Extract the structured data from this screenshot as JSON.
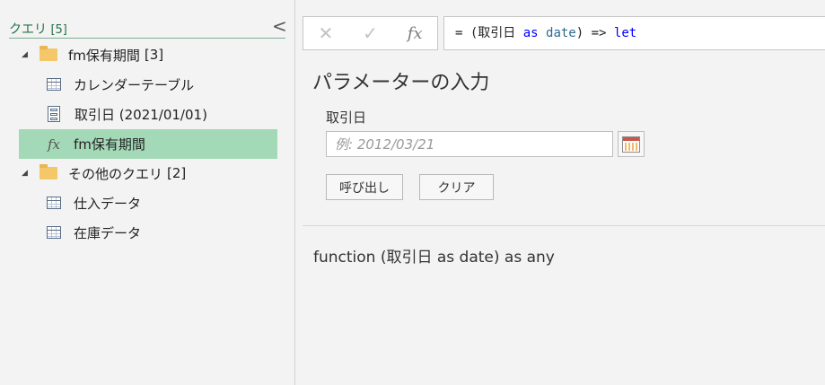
{
  "queries_pane": {
    "title": "クエリ",
    "count": "[5]",
    "collapse_glyph": "<",
    "groups": [
      {
        "name": "fm保有期間",
        "count": "[3]",
        "items": [
          {
            "label": "カレンダーテーブル",
            "icon": "table-icon"
          },
          {
            "label": "取引日 (2021/01/01)",
            "icon": "parameter-icon"
          },
          {
            "label": "fm保有期間",
            "icon": "function-icon",
            "selected": true
          }
        ]
      },
      {
        "name": "その他のクエリ",
        "count": "[2]",
        "items": [
          {
            "label": "仕入データ",
            "icon": "table-icon"
          },
          {
            "label": "在庫データ",
            "icon": "table-icon"
          }
        ]
      }
    ]
  },
  "formula_bar": {
    "cancel_glyph": "✕",
    "confirm_glyph": "✓",
    "fx_glyph": "fx",
    "formula_parts": {
      "p1": "= (取引日 ",
      "p2": "as",
      "p3": " ",
      "p4": "date",
      "p5": ") => ",
      "p6": "let"
    }
  },
  "parameter_panel": {
    "title": "パラメーターの入力",
    "param_label": "取引日",
    "date_placeholder": "例: 2012/03/21",
    "date_value": "",
    "invoke_label": "呼び出し",
    "clear_label": "クリア",
    "signature": "function (取引日 as date) as any"
  },
  "colors": {
    "accent": "#217346",
    "selected_row": "#a4d9b8",
    "keyword": "#0000ff"
  }
}
